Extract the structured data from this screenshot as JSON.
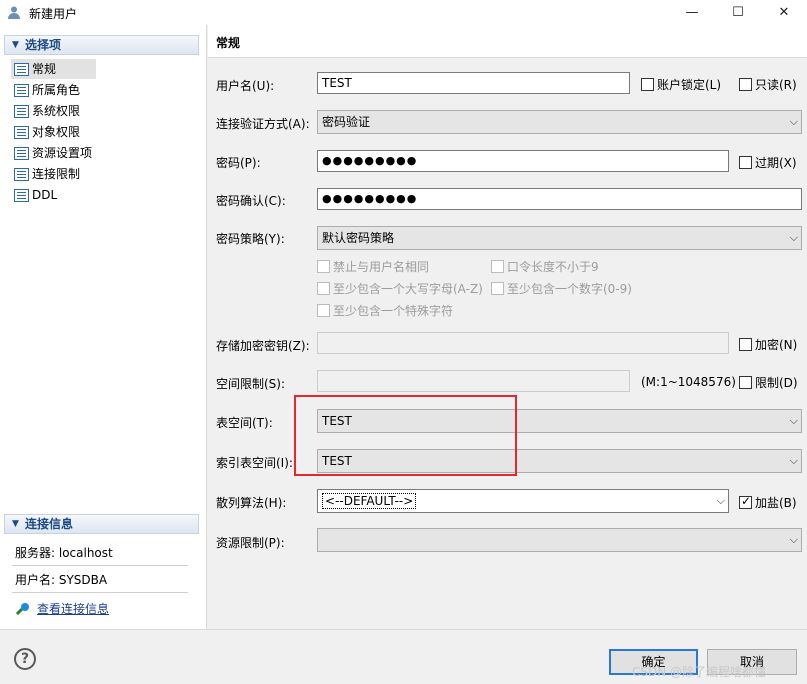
{
  "window": {
    "title": "新建用户",
    "minimize": "—",
    "maximize": "☐",
    "close": "✕"
  },
  "left": {
    "options_header": "选择项",
    "nav": [
      "常规",
      "所属角色",
      "系统权限",
      "对象权限",
      "资源设置项",
      "连接限制",
      "DDL"
    ],
    "conn_header": "连接信息",
    "server": "服务器: localhost",
    "user": "用户名: SYSDBA",
    "view_link": "查看连接信息"
  },
  "form": {
    "section_title": "常规",
    "username_label": "用户名(U):",
    "username_value": "TEST",
    "lock_label": "账户锁定(L)",
    "readonly_label": "只读(R)",
    "auth_label": "连接验证方式(A):",
    "auth_value": "密码验证",
    "password_label": "密码(P):",
    "password_value": "●●●●●●●●●",
    "expire_label": "过期(X)",
    "confirm_label": "密码确认(C):",
    "confirm_value": "●●●●●●●●●",
    "policy_label": "密码策略(Y):",
    "policy_value": "默认密码策略",
    "policy_opts": [
      "禁止与用户名相同",
      "口令长度不小于9",
      "至少包含一个大写字母(A-Z)",
      "至少包含一个数字(0-9)",
      "至少包含一个特殊字符"
    ],
    "storekey_label": "存储加密密钥(Z):",
    "encrypt_label": "加密(N)",
    "space_label": "空间限制(S):",
    "space_range": "(M:1~1048576)",
    "limit_label": "限制(D)",
    "tablespace_label": "表空间(T):",
    "tablespace_value": "TEST",
    "index_label": "索引表空间(I):",
    "index_value": "TEST",
    "hash_label": "散列算法(H):",
    "hash_value": "<--DEFAULT-->",
    "salt_label": "加盐(B)",
    "resource_label": "资源限制(P):"
  },
  "footer": {
    "help": "?",
    "ok": "确定",
    "cancel": "取消",
    "watermark": "CSDN @除了编程啥都懂"
  }
}
